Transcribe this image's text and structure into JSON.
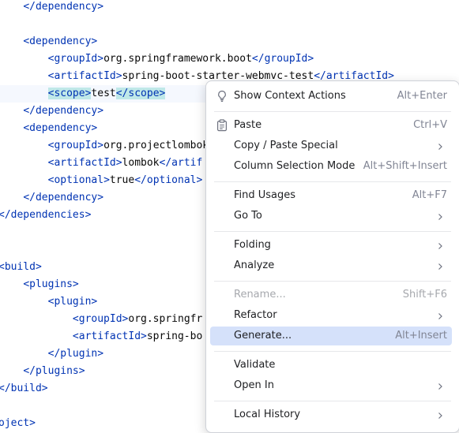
{
  "editor": {
    "lines": [
      {
        "segs": [
          {
            "t": "    "
          },
          {
            "t": "</dependency>",
            "c": "tag"
          }
        ]
      },
      {
        "segs": []
      },
      {
        "segs": [
          {
            "t": "    "
          },
          {
            "t": "<dependency>",
            "c": "tag"
          }
        ]
      },
      {
        "segs": [
          {
            "t": "        "
          },
          {
            "t": "<groupId>",
            "c": "tag"
          },
          {
            "t": "org.springframework.boot",
            "c": "txt"
          },
          {
            "t": "</groupId>",
            "c": "tag"
          }
        ]
      },
      {
        "segs": [
          {
            "t": "        "
          },
          {
            "t": "<artifactId>",
            "c": "tag"
          },
          {
            "t": "spring-boot-starter-webmvc-test",
            "c": "txt"
          },
          {
            "t": "</artifactId>",
            "c": "tag"
          }
        ]
      },
      {
        "current": true,
        "segs": [
          {
            "t": "        "
          },
          {
            "t": "<scope>",
            "c": "tag",
            "h": true
          },
          {
            "t": "test",
            "c": "txt"
          },
          {
            "t": "</scope>",
            "c": "tag",
            "h": true
          }
        ]
      },
      {
        "segs": [
          {
            "t": "    "
          },
          {
            "t": "</dependency>",
            "c": "tag"
          }
        ]
      },
      {
        "segs": [
          {
            "t": "    "
          },
          {
            "t": "<dependency>",
            "c": "tag"
          }
        ]
      },
      {
        "segs": [
          {
            "t": "        "
          },
          {
            "t": "<groupId>",
            "c": "tag"
          },
          {
            "t": "org.projectlombok",
            "c": "txt"
          }
        ]
      },
      {
        "segs": [
          {
            "t": "        "
          },
          {
            "t": "<artifactId>",
            "c": "tag"
          },
          {
            "t": "lombok",
            "c": "txt"
          },
          {
            "t": "</artif",
            "c": "tag"
          }
        ]
      },
      {
        "segs": [
          {
            "t": "        "
          },
          {
            "t": "<optional>",
            "c": "tag"
          },
          {
            "t": "true",
            "c": "txt"
          },
          {
            "t": "</optional>",
            "c": "tag"
          }
        ]
      },
      {
        "segs": [
          {
            "t": "    "
          },
          {
            "t": "</dependency>",
            "c": "tag"
          }
        ]
      },
      {
        "segs": [
          {
            "t": "</dependencies>",
            "c": "tag"
          }
        ]
      },
      {
        "segs": []
      },
      {
        "segs": []
      },
      {
        "segs": [
          {
            "t": "<build>",
            "c": "tag"
          }
        ]
      },
      {
        "segs": [
          {
            "t": "    "
          },
          {
            "t": "<plugins>",
            "c": "tag"
          }
        ]
      },
      {
        "segs": [
          {
            "t": "        "
          },
          {
            "t": "<plugin>",
            "c": "tag"
          }
        ]
      },
      {
        "segs": [
          {
            "t": "            "
          },
          {
            "t": "<groupId>",
            "c": "tag"
          },
          {
            "t": "org.springfr",
            "c": "txt"
          }
        ]
      },
      {
        "segs": [
          {
            "t": "            "
          },
          {
            "t": "<artifactId>",
            "c": "tag"
          },
          {
            "t": "spring-bo",
            "c": "txt"
          }
        ]
      },
      {
        "segs": [
          {
            "t": "        "
          },
          {
            "t": "</plugin>",
            "c": "tag"
          }
        ]
      },
      {
        "segs": [
          {
            "t": "    "
          },
          {
            "t": "</plugins>",
            "c": "tag"
          }
        ]
      },
      {
        "segs": [
          {
            "t": "</build>",
            "c": "tag"
          }
        ]
      },
      {
        "segs": []
      },
      {
        "segs": [
          {
            "t": "oject>",
            "c": "tag"
          }
        ]
      }
    ]
  },
  "context_menu": {
    "items": [
      {
        "label": "Show Context Actions",
        "shortcut": "Alt+Enter",
        "icon": "lightbulb-icon"
      },
      {
        "sep": true
      },
      {
        "label": "Paste",
        "shortcut": "Ctrl+V",
        "icon": "clipboard-icon"
      },
      {
        "label": "Copy / Paste Special",
        "submenu": true
      },
      {
        "label": "Column Selection Mode",
        "shortcut": "Alt+Shift+Insert"
      },
      {
        "sep": true
      },
      {
        "label": "Find Usages",
        "shortcut": "Alt+F7"
      },
      {
        "label": "Go To",
        "submenu": true
      },
      {
        "sep": true
      },
      {
        "label": "Folding",
        "submenu": true
      },
      {
        "label": "Analyze",
        "submenu": true
      },
      {
        "sep": true
      },
      {
        "label": "Rename...",
        "shortcut": "Shift+F6",
        "disabled": true
      },
      {
        "label": "Refactor",
        "submenu": true
      },
      {
        "label": "Generate...",
        "shortcut": "Alt+Insert",
        "selected": true
      },
      {
        "sep": true
      },
      {
        "label": "Validate"
      },
      {
        "label": "Open In",
        "submenu": true
      },
      {
        "sep": true
      },
      {
        "label": "Local History",
        "submenu": true
      }
    ]
  },
  "colors": {
    "tag": "#0033b3",
    "text": "#080808",
    "tag_highlight": "#bfe8e8",
    "menu_selected": "#d5e1fa",
    "shortcut": "#818594"
  }
}
